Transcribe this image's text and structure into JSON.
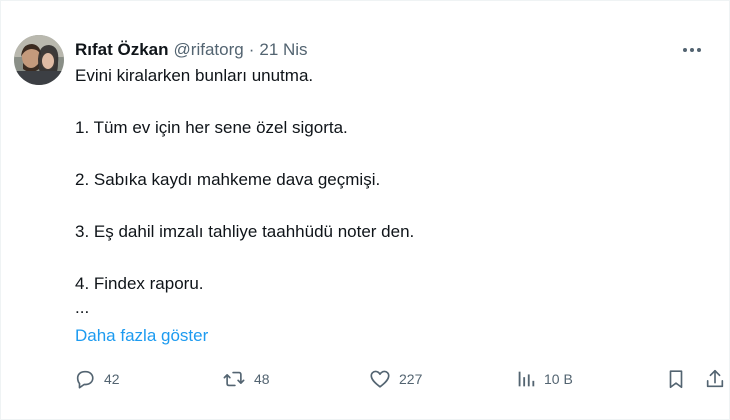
{
  "tweet": {
    "author_name": "Rıfat Özkan",
    "handle": "@rifatorg",
    "separator": "·",
    "date": "21 Nis",
    "lines": [
      "Evini kiralarken bunları unutma.",
      "",
      "1. Tüm ev için her sene özel sigorta.",
      "",
      "2. Sabıka kaydı mahkeme dava geçmişi.",
      "",
      "3. Eş dahil imzalı tahliye taahhüdü noter den.",
      "",
      "4. Findex raporu.",
      "..."
    ],
    "show_more": "Daha fazla göster"
  },
  "actions": {
    "replies": "42",
    "retweets": "48",
    "likes": "227",
    "views": "10 B"
  },
  "icons": {
    "more": "more-horizontal-icon",
    "reply": "reply-icon",
    "retweet": "retweet-icon",
    "like": "heart-icon",
    "views": "views-chart-icon",
    "bookmark": "bookmark-icon",
    "share": "share-icon"
  },
  "colors": {
    "text": "#0f1419",
    "secondary": "#536471",
    "link": "#1d9bf0",
    "border": "#eff3f4"
  }
}
